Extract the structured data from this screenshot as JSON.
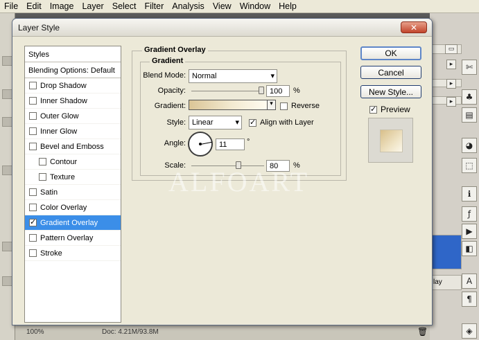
{
  "menu": [
    "File",
    "Edit",
    "Image",
    "Layer",
    "Select",
    "Filter",
    "Analysis",
    "View",
    "Window",
    "Help"
  ],
  "status": {
    "doc": "Doc: 4.21M/93.8M",
    "zoom": "100%"
  },
  "dialog": {
    "title": "Layer Style",
    "close_glyph": "✕",
    "styles_header": "Styles",
    "blending_options": "Blending Options: Default",
    "style_items": [
      {
        "label": "Drop Shadow",
        "checked": false,
        "sub": false,
        "selected": false
      },
      {
        "label": "Inner Shadow",
        "checked": false,
        "sub": false,
        "selected": false
      },
      {
        "label": "Outer Glow",
        "checked": false,
        "sub": false,
        "selected": false
      },
      {
        "label": "Inner Glow",
        "checked": false,
        "sub": false,
        "selected": false
      },
      {
        "label": "Bevel and Emboss",
        "checked": false,
        "sub": false,
        "selected": false
      },
      {
        "label": "Contour",
        "checked": false,
        "sub": true,
        "selected": false
      },
      {
        "label": "Texture",
        "checked": false,
        "sub": true,
        "selected": false
      },
      {
        "label": "Satin",
        "checked": false,
        "sub": false,
        "selected": false
      },
      {
        "label": "Color Overlay",
        "checked": false,
        "sub": false,
        "selected": false
      },
      {
        "label": "Gradient Overlay",
        "checked": true,
        "sub": false,
        "selected": true
      },
      {
        "label": "Pattern Overlay",
        "checked": false,
        "sub": false,
        "selected": false
      },
      {
        "label": "Stroke",
        "checked": false,
        "sub": false,
        "selected": false
      }
    ],
    "panel": {
      "outer_title": "Gradient Overlay",
      "inner_title": "Gradient",
      "blend_mode_label": "Blend Mode:",
      "blend_mode_value": "Normal",
      "opacity_label": "Opacity:",
      "opacity_value": "100",
      "opacity_unit": "%",
      "opacity_fraction": 1.0,
      "gradient_label": "Gradient:",
      "reverse_label": "Reverse",
      "reverse_checked": false,
      "style_label": "Style:",
      "style_value": "Linear",
      "align_label": "Align with Layer",
      "align_checked": true,
      "angle_label": "Angle:",
      "angle_value": "11",
      "angle_unit": "°",
      "scale_label": "Scale:",
      "scale_value": "80",
      "scale_unit": "%",
      "scale_fraction": 0.8,
      "gradient_colors": [
        "#dbc597",
        "#f3ead1",
        "#fffbf0"
      ]
    },
    "buttons": {
      "ok": "OK",
      "cancel": "Cancel",
      "new_style": "New Style..."
    },
    "preview_label": "Preview",
    "preview_checked": true
  },
  "watermark": "ALFOART"
}
